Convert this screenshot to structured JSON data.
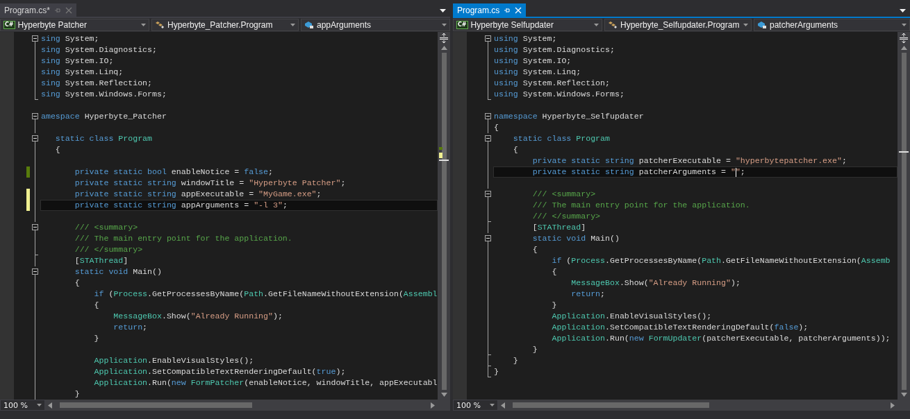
{
  "panes": [
    {
      "tab": {
        "label": "Program.cs*",
        "selected": false
      },
      "navigation": [
        {
          "kind": "project",
          "badge": "C#",
          "label": "Hyperbyte Patcher"
        },
        {
          "kind": "class",
          "label": "Hyperbyte_Patcher.Program"
        },
        {
          "kind": "member",
          "label": "appArguments"
        }
      ],
      "lines": [
        {
          "kind": "fold-start",
          "modified": false,
          "current": false,
          "tokens": [
            {
              "kind": "kw",
              "text": "sing"
            },
            {
              "kind": "plain",
              "text": " System;"
            }
          ]
        },
        {
          "kind": "fold-guide",
          "modified": false,
          "current": false,
          "tokens": [
            {
              "kind": "kw",
              "text": "sing"
            },
            {
              "kind": "plain",
              "text": " System.Diagnostics;"
            }
          ]
        },
        {
          "kind": "fold-guide",
          "modified": false,
          "current": false,
          "tokens": [
            {
              "kind": "kw",
              "text": "sing"
            },
            {
              "kind": "plain",
              "text": " System.IO;"
            }
          ]
        },
        {
          "kind": "fold-guide",
          "modified": false,
          "current": false,
          "tokens": [
            {
              "kind": "kw",
              "text": "sing"
            },
            {
              "kind": "plain",
              "text": " System.Linq;"
            }
          ]
        },
        {
          "kind": "fold-guide",
          "modified": false,
          "current": false,
          "tokens": [
            {
              "kind": "kw",
              "text": "sing"
            },
            {
              "kind": "plain",
              "text": " System.Reflection;"
            }
          ]
        },
        {
          "kind": "fold-end",
          "modified": false,
          "current": false,
          "tokens": [
            {
              "kind": "kw",
              "text": "sing"
            },
            {
              "kind": "plain",
              "text": " System.Windows.Forms;"
            }
          ]
        },
        {
          "kind": "plain",
          "modified": false,
          "current": false
        },
        {
          "kind": "fold-start",
          "modified": false,
          "current": false,
          "tokens": [
            {
              "kind": "kw",
              "text": "amespace"
            },
            {
              "kind": "plain",
              "text": " Hyperbyte_Patcher"
            }
          ]
        },
        {
          "kind": "fold-guide",
          "modified": false,
          "current": false
        },
        {
          "kind": "fold-start",
          "modified": false,
          "current": false,
          "tokens": [
            {
              "kind": "kw",
              "text": "   static class "
            },
            {
              "kind": "type",
              "text": "Program"
            }
          ]
        },
        {
          "kind": "fold-guide",
          "modified": false,
          "current": false,
          "tokens": [
            {
              "kind": "plain",
              "text": "   {"
            }
          ]
        },
        {
          "kind": "fold-guide",
          "modified": false,
          "current": false
        },
        {
          "kind": "fold-guide",
          "modified": true,
          "saved": true,
          "current": false,
          "tokens": [
            {
              "kind": "kw",
              "text": "       private static bool"
            },
            {
              "kind": "plain",
              "text": " enableNotice = "
            },
            {
              "kind": "kw",
              "text": "false"
            },
            {
              "kind": "plain",
              "text": ";"
            }
          ]
        },
        {
          "kind": "fold-guide",
          "modified": false,
          "current": false,
          "tokens": [
            {
              "kind": "kw",
              "text": "       private static string"
            },
            {
              "kind": "plain",
              "text": " windowTitle = "
            },
            {
              "kind": "str",
              "text": "\"Hyperbyte Patcher\""
            },
            {
              "kind": "plain",
              "text": ";"
            }
          ]
        },
        {
          "kind": "fold-guide",
          "modified": true,
          "saved": false,
          "current": false,
          "tokens": [
            {
              "kind": "kw",
              "text": "       private static string"
            },
            {
              "kind": "plain",
              "text": " appExecutable = "
            },
            {
              "kind": "str",
              "text": "\"MyGame.exe\""
            },
            {
              "kind": "plain",
              "text": ";"
            }
          ]
        },
        {
          "kind": "fold-guide",
          "modified": true,
          "saved": false,
          "current": true,
          "tokens": [
            {
              "kind": "kw",
              "text": "       private static string"
            },
            {
              "kind": "plain",
              "text": " appArguments = "
            },
            {
              "kind": "str",
              "text": "\"-l 3\""
            },
            {
              "kind": "plain",
              "text": ";"
            }
          ]
        },
        {
          "kind": "fold-guide",
          "modified": false,
          "current": false
        },
        {
          "kind": "fold-start",
          "modified": false,
          "current": false,
          "tokens": [
            {
              "kind": "cmt",
              "text": "       /// <summary>"
            }
          ]
        },
        {
          "kind": "fold-guide",
          "modified": false,
          "current": false,
          "tokens": [
            {
              "kind": "cmt",
              "text": "       /// The main entry point for the application."
            }
          ]
        },
        {
          "kind": "fold-end",
          "modified": false,
          "current": false,
          "tokens": [
            {
              "kind": "cmt",
              "text": "       /// </summary>"
            }
          ]
        },
        {
          "kind": "fold-guide",
          "modified": false,
          "current": false,
          "tokens": [
            {
              "kind": "plain",
              "text": "       ["
            },
            {
              "kind": "type",
              "text": "STAThread"
            },
            {
              "kind": "plain",
              "text": "]"
            }
          ]
        },
        {
          "kind": "fold-start",
          "modified": false,
          "current": false,
          "tokens": [
            {
              "kind": "kw",
              "text": "       static void"
            },
            {
              "kind": "plain",
              "text": " Main()"
            }
          ]
        },
        {
          "kind": "fold-guide",
          "modified": false,
          "current": false,
          "tokens": [
            {
              "kind": "plain",
              "text": "       {"
            }
          ]
        },
        {
          "kind": "fold-guide",
          "modified": false,
          "current": false,
          "tokens": [
            {
              "kind": "kw",
              "text": "           if"
            },
            {
              "kind": "plain",
              "text": " ("
            },
            {
              "kind": "type",
              "text": "Process"
            },
            {
              "kind": "plain",
              "text": ".GetProcessesByName("
            },
            {
              "kind": "type",
              "text": "Path"
            },
            {
              "kind": "plain",
              "text": ".GetFileNameWithoutExtension("
            },
            {
              "kind": "type",
              "text": "Assembl"
            }
          ]
        },
        {
          "kind": "fold-guide",
          "modified": false,
          "current": false,
          "tokens": [
            {
              "kind": "plain",
              "text": "           {"
            }
          ]
        },
        {
          "kind": "fold-guide",
          "modified": false,
          "current": false,
          "tokens": [
            {
              "kind": "type",
              "text": "               MessageBox"
            },
            {
              "kind": "plain",
              "text": ".Show("
            },
            {
              "kind": "str",
              "text": "\"Already Running\""
            },
            {
              "kind": "plain",
              "text": ");"
            }
          ]
        },
        {
          "kind": "fold-guide",
          "modified": false,
          "current": false,
          "tokens": [
            {
              "kind": "kw",
              "text": "               return"
            },
            {
              "kind": "plain",
              "text": ";"
            }
          ]
        },
        {
          "kind": "fold-guide",
          "modified": false,
          "current": false,
          "tokens": [
            {
              "kind": "plain",
              "text": "           }"
            }
          ]
        },
        {
          "kind": "fold-guide",
          "modified": false,
          "current": false
        },
        {
          "kind": "fold-guide",
          "modified": false,
          "current": false,
          "tokens": [
            {
              "kind": "type",
              "text": "           Application"
            },
            {
              "kind": "plain",
              "text": ".EnableVisualStyles();"
            }
          ]
        },
        {
          "kind": "fold-guide",
          "modified": false,
          "current": false,
          "tokens": [
            {
              "kind": "type",
              "text": "           Application"
            },
            {
              "kind": "plain",
              "text": ".SetCompatibleTextRenderingDefault("
            },
            {
              "kind": "kw",
              "text": "true"
            },
            {
              "kind": "plain",
              "text": ");"
            }
          ]
        },
        {
          "kind": "fold-guide",
          "modified": false,
          "current": false,
          "tokens": [
            {
              "kind": "type",
              "text": "           Application"
            },
            {
              "kind": "plain",
              "text": ".Run("
            },
            {
              "kind": "kw",
              "text": "new "
            },
            {
              "kind": "type",
              "text": "FormPatcher"
            },
            {
              "kind": "plain",
              "text": "(enableNotice, windowTitle, appExecutabl"
            }
          ]
        },
        {
          "kind": "fold-guide",
          "modified": false,
          "current": false,
          "tokens": [
            {
              "kind": "plain",
              "text": "       }"
            }
          ]
        }
      ],
      "zoom": "100 %"
    },
    {
      "tab": {
        "label": "Program.cs",
        "selected": true
      },
      "navigation": [
        {
          "kind": "project",
          "badge": "C#",
          "label": "Hyperbyte Selfupdater"
        },
        {
          "kind": "class",
          "label": "Hyperbyte_Selfupdater.Program"
        },
        {
          "kind": "member",
          "label": "patcherArguments"
        }
      ],
      "lines": [
        {
          "kind": "fold-start",
          "modified": false,
          "current": false,
          "tokens": [
            {
              "kind": "kw",
              "text": "using"
            },
            {
              "kind": "plain",
              "text": " System;"
            }
          ]
        },
        {
          "kind": "fold-guide",
          "modified": false,
          "current": false,
          "tokens": [
            {
              "kind": "kw",
              "text": "using"
            },
            {
              "kind": "plain",
              "text": " System.Diagnostics;"
            }
          ]
        },
        {
          "kind": "fold-guide",
          "modified": false,
          "current": false,
          "tokens": [
            {
              "kind": "kw",
              "text": "using"
            },
            {
              "kind": "plain",
              "text": " System.IO;"
            }
          ]
        },
        {
          "kind": "fold-guide",
          "modified": false,
          "current": false,
          "tokens": [
            {
              "kind": "kw",
              "text": "using"
            },
            {
              "kind": "plain",
              "text": " System.Linq;"
            }
          ]
        },
        {
          "kind": "fold-guide",
          "modified": false,
          "current": false,
          "tokens": [
            {
              "kind": "kw",
              "text": "using"
            },
            {
              "kind": "plain",
              "text": " System.Reflection;"
            }
          ]
        },
        {
          "kind": "fold-end",
          "modified": false,
          "current": false,
          "tokens": [
            {
              "kind": "kw",
              "text": "using"
            },
            {
              "kind": "plain",
              "text": " System.Windows.Forms;"
            }
          ]
        },
        {
          "kind": "plain",
          "modified": false,
          "current": false
        },
        {
          "kind": "fold-start",
          "modified": false,
          "current": false,
          "tokens": [
            {
              "kind": "kw",
              "text": "namespace"
            },
            {
              "kind": "plain",
              "text": " Hyperbyte_Selfupdater"
            }
          ]
        },
        {
          "kind": "fold-guide",
          "modified": false,
          "current": false,
          "tokens": [
            {
              "kind": "plain",
              "text": "{"
            }
          ]
        },
        {
          "kind": "fold-start",
          "modified": false,
          "current": false,
          "tokens": [
            {
              "kind": "kw",
              "text": "    static class "
            },
            {
              "kind": "type",
              "text": "Program"
            }
          ]
        },
        {
          "kind": "fold-guide",
          "modified": false,
          "current": false,
          "tokens": [
            {
              "kind": "plain",
              "text": "    {"
            }
          ]
        },
        {
          "kind": "fold-guide",
          "modified": false,
          "current": false,
          "tokens": [
            {
              "kind": "kw",
              "text": "        private static string"
            },
            {
              "kind": "plain",
              "text": " patcherExecutable = "
            },
            {
              "kind": "str",
              "text": "\"hyperbytepatcher.exe\""
            },
            {
              "kind": "plain",
              "text": ";"
            }
          ]
        },
        {
          "kind": "fold-guide",
          "modified": false,
          "current": true,
          "tokens": [
            {
              "kind": "kw",
              "text": "        private static string"
            },
            {
              "kind": "plain",
              "text": " patcherArguments = "
            },
            {
              "kind": "str",
              "text": "\""
            },
            {
              "kind": "str",
              "text": "\"",
              "caret_before": true
            },
            {
              "kind": "plain",
              "text": ";"
            }
          ]
        },
        {
          "kind": "fold-guide",
          "modified": false,
          "current": false
        },
        {
          "kind": "fold-start",
          "modified": false,
          "current": false,
          "tokens": [
            {
              "kind": "cmt",
              "text": "        /// <summary>"
            }
          ]
        },
        {
          "kind": "fold-guide",
          "modified": false,
          "current": false,
          "tokens": [
            {
              "kind": "cmt",
              "text": "        /// The main entry point for the application."
            }
          ]
        },
        {
          "kind": "fold-end",
          "modified": false,
          "current": false,
          "tokens": [
            {
              "kind": "cmt",
              "text": "        /// </summary>"
            }
          ]
        },
        {
          "kind": "fold-guide",
          "modified": false,
          "current": false,
          "tokens": [
            {
              "kind": "plain",
              "text": "        ["
            },
            {
              "kind": "type",
              "text": "STAThread"
            },
            {
              "kind": "plain",
              "text": "]"
            }
          ]
        },
        {
          "kind": "fold-start",
          "modified": false,
          "current": false,
          "tokens": [
            {
              "kind": "kw",
              "text": "        static void"
            },
            {
              "kind": "plain",
              "text": " Main()"
            }
          ]
        },
        {
          "kind": "fold-guide",
          "modified": false,
          "current": false,
          "tokens": [
            {
              "kind": "plain",
              "text": "        {"
            }
          ]
        },
        {
          "kind": "fold-guide",
          "modified": false,
          "current": false,
          "tokens": [
            {
              "kind": "kw",
              "text": "            if"
            },
            {
              "kind": "plain",
              "text": " ("
            },
            {
              "kind": "type",
              "text": "Process"
            },
            {
              "kind": "plain",
              "text": ".GetProcessesByName("
            },
            {
              "kind": "type",
              "text": "Path"
            },
            {
              "kind": "plain",
              "text": ".GetFileNameWithoutExtension("
            },
            {
              "kind": "type",
              "text": "Assemb"
            }
          ]
        },
        {
          "kind": "fold-guide",
          "modified": false,
          "current": false,
          "tokens": [
            {
              "kind": "plain",
              "text": "            {"
            }
          ]
        },
        {
          "kind": "fold-guide",
          "modified": false,
          "current": false,
          "tokens": [
            {
              "kind": "type",
              "text": "                MessageBox"
            },
            {
              "kind": "plain",
              "text": ".Show("
            },
            {
              "kind": "str",
              "text": "\"Already Running\""
            },
            {
              "kind": "plain",
              "text": ");"
            }
          ]
        },
        {
          "kind": "fold-guide",
          "modified": false,
          "current": false,
          "tokens": [
            {
              "kind": "kw",
              "text": "                return"
            },
            {
              "kind": "plain",
              "text": ";"
            }
          ]
        },
        {
          "kind": "fold-guide",
          "modified": false,
          "current": false,
          "tokens": [
            {
              "kind": "plain",
              "text": "            }"
            }
          ]
        },
        {
          "kind": "fold-guide",
          "modified": false,
          "current": false,
          "tokens": [
            {
              "kind": "type",
              "text": "            Application"
            },
            {
              "kind": "plain",
              "text": ".EnableVisualStyles();"
            }
          ]
        },
        {
          "kind": "fold-guide",
          "modified": false,
          "current": false,
          "tokens": [
            {
              "kind": "type",
              "text": "            Application"
            },
            {
              "kind": "plain",
              "text": ".SetCompatibleTextRenderingDefault("
            },
            {
              "kind": "kw",
              "text": "false"
            },
            {
              "kind": "plain",
              "text": ");"
            }
          ]
        },
        {
          "kind": "fold-guide",
          "modified": false,
          "current": false,
          "tokens": [
            {
              "kind": "type",
              "text": "            Application"
            },
            {
              "kind": "plain",
              "text": ".Run("
            },
            {
              "kind": "kw",
              "text": "new "
            },
            {
              "kind": "type",
              "text": "FormUpdater"
            },
            {
              "kind": "plain",
              "text": "(patcherExecutable, patcherArguments));"
            }
          ]
        },
        {
          "kind": "fold-end",
          "modified": false,
          "current": false,
          "tokens": [
            {
              "kind": "plain",
              "text": "        }"
            }
          ]
        },
        {
          "kind": "fold-end",
          "modified": false,
          "current": false,
          "tokens": [
            {
              "kind": "plain",
              "text": "    }"
            }
          ]
        },
        {
          "kind": "fold-end",
          "modified": false,
          "current": false,
          "tokens": [
            {
              "kind": "plain",
              "text": "}"
            }
          ]
        }
      ],
      "zoom": "100 %"
    }
  ]
}
